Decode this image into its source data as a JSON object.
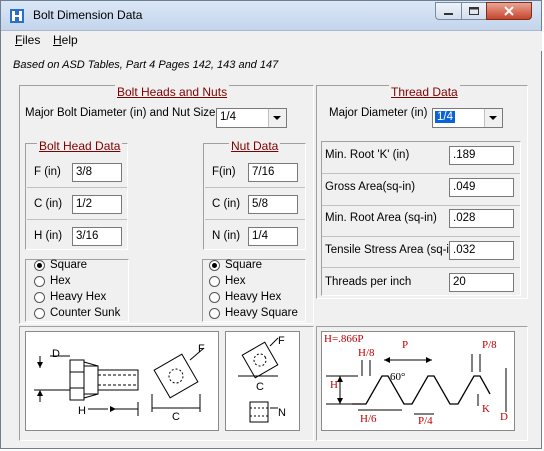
{
  "window": {
    "title": "Bolt Dimension Data"
  },
  "menu": {
    "files": "Files",
    "help": "Help"
  },
  "subtitle": "Based on ASD Tables, Part 4 Pages 142, 143 and 147",
  "bolt_nuts": {
    "title": "Bolt Heads and Nuts",
    "major_label": "Major Bolt Diameter (in) and Nut Size",
    "major_value": "1/4",
    "bolt_head": {
      "title": "Bolt Head Data",
      "f_label": "F (in)",
      "f_value": "3/8",
      "c_label": "C (in)",
      "c_value": "1/2",
      "h_label": "H (in)",
      "h_value": "3/16"
    },
    "nut": {
      "title": "Nut Data",
      "f_label": "F(in)",
      "f_value": "7/16",
      "c_label": "C (in)",
      "c_value": "5/8",
      "n_label": "N (in)",
      "n_value": "1/4"
    },
    "head_types": [
      "Square",
      "Hex",
      "Heavy Hex",
      "Counter Sunk"
    ],
    "nut_types": [
      "Square",
      "Hex",
      "Heavy Hex",
      "Heavy Square"
    ]
  },
  "thread": {
    "title": "Thread Data",
    "major_label": "Major Diameter (in)",
    "major_value": "1/4",
    "rows": [
      {
        "label": "Min. Root 'K' (in)",
        "value": ".189"
      },
      {
        "label": "Gross Area(sq-in)",
        "value": ".049"
      },
      {
        "label": "Min. Root Area (sq-in)",
        "value": ".028"
      },
      {
        "label": "Tensile Stress Area (sq-in)",
        "value": ".032"
      },
      {
        "label": "Threads per inch",
        "value": "20"
      }
    ]
  },
  "diagram_bolt": {
    "d": "D",
    "h": "H",
    "c": "C",
    "f": "F"
  },
  "diagram_nut": {
    "f": "F",
    "c": "C",
    "n": "N"
  },
  "diagram_thread": {
    "h_formula": "H=.866P",
    "h8": "H/8",
    "p": "P",
    "p8": "P/8",
    "h": "H",
    "angle": "60°",
    "h6": "H/6",
    "p4": "P/4",
    "k": "K",
    "d": "D"
  }
}
